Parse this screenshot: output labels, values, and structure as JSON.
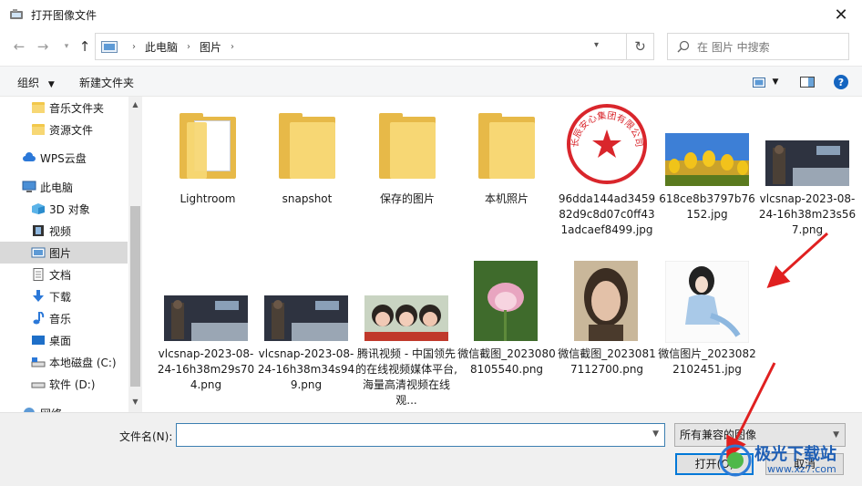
{
  "window": {
    "title": "打开图像文件"
  },
  "address": {
    "crumbs": [
      "此电脑",
      "图片"
    ],
    "search_placeholder": "在 图片 中搜索"
  },
  "toolbar": {
    "organize": "组织",
    "new_folder": "新建文件夹"
  },
  "sidebar": {
    "items": [
      {
        "label": "音乐文件夹",
        "icon": "folder-icon"
      },
      {
        "label": "资源文件",
        "icon": "folder-icon"
      },
      {
        "label": "WPS云盘",
        "icon": "cloud-icon"
      },
      {
        "label": "此电脑",
        "icon": "computer-icon"
      },
      {
        "label": "3D 对象",
        "icon": "cube-icon"
      },
      {
        "label": "视频",
        "icon": "video-icon"
      },
      {
        "label": "图片",
        "icon": "pictures-icon",
        "selected": true
      },
      {
        "label": "文档",
        "icon": "document-icon"
      },
      {
        "label": "下载",
        "icon": "download-icon"
      },
      {
        "label": "音乐",
        "icon": "music-icon"
      },
      {
        "label": "桌面",
        "icon": "desktop-icon"
      },
      {
        "label": "本地磁盘 (C:)",
        "icon": "drive-icon"
      },
      {
        "label": "软件 (D:)",
        "icon": "drive-icon"
      },
      {
        "label": "网络",
        "icon": "network-icon"
      }
    ]
  },
  "files": [
    {
      "name": "Lightroom",
      "kind": "folder-doc"
    },
    {
      "name": "snapshot",
      "kind": "folder"
    },
    {
      "name": "保存的图片",
      "kind": "folder"
    },
    {
      "name": "本机照片",
      "kind": "folder"
    },
    {
      "name": "96dda144ad345982d9c8d07c0ff431adcaef8499.jpg",
      "kind": "stamp",
      "stamp_text": "长辰安心集团有限公司"
    },
    {
      "name": "618ce8b3797b76152.jpg",
      "kind": "tulips"
    },
    {
      "name": "vlcsnap-2023-08-24-16h38m23s567.png",
      "kind": "bedroom"
    },
    {
      "name": "vlcsnap-2023-08-24-16h38m29s704.png",
      "kind": "bedroom"
    },
    {
      "name": "vlcsnap-2023-08-24-16h38m34s949.png",
      "kind": "bedroom"
    },
    {
      "name": "腾讯视频 - 中国领先的在线视频媒体平台,海量高清视频在线观...",
      "kind": "people"
    },
    {
      "name": "微信截图_20230808105540.png",
      "kind": "lotus"
    },
    {
      "name": "微信截图_20230817112700.png",
      "kind": "portrait"
    },
    {
      "name": "微信图片_20230822102451.jpg",
      "kind": "sketch"
    }
  ],
  "bottom": {
    "filename_label": "文件名(N):",
    "filename_value": "",
    "filter_value": "所有兼容的图像",
    "open_label": "打开(O)",
    "cancel_label": "取消"
  },
  "watermark": {
    "text": "极光下载站",
    "url": "www.xz7.com"
  },
  "colors": {
    "accent": "#0078d7",
    "selection": "#d9d9d9",
    "folder": "#f7d774",
    "arrow": "#e02020"
  }
}
